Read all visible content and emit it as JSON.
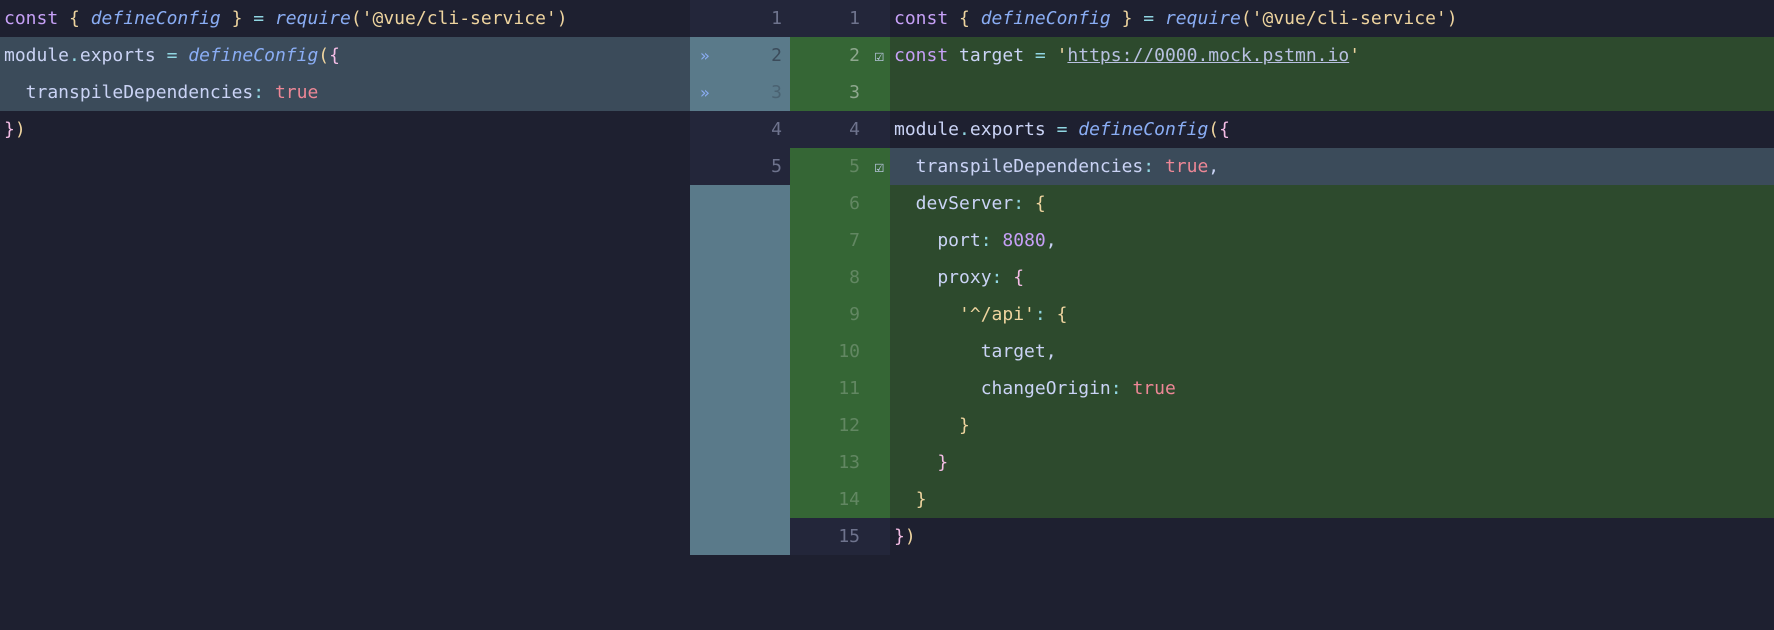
{
  "left": {
    "lines": [
      {
        "n": 1,
        "bg": "default",
        "tokens": [
          {
            "t": "const ",
            "c": "kw"
          },
          {
            "t": "{ ",
            "c": "paren-yellow"
          },
          {
            "t": "defineConfig",
            "c": "fn"
          },
          {
            "t": " }",
            "c": "paren-yellow"
          },
          {
            "t": " = ",
            "c": "op"
          },
          {
            "t": "require",
            "c": "fn"
          },
          {
            "t": "(",
            "c": "paren-yellow"
          },
          {
            "t": "'@vue/cli-service'",
            "c": "str"
          },
          {
            "t": ")",
            "c": "paren-yellow"
          }
        ]
      },
      {
        "n": 2,
        "bg": "modified-left",
        "tokens": [
          {
            "t": "module",
            "c": "default"
          },
          {
            "t": ".",
            "c": "op"
          },
          {
            "t": "exports",
            "c": "default"
          },
          {
            "t": " = ",
            "c": "op"
          },
          {
            "t": "defineConfig",
            "c": "fn"
          },
          {
            "t": "(",
            "c": "paren-yellow"
          },
          {
            "t": "{",
            "c": "paren-pink"
          }
        ]
      },
      {
        "n": 3,
        "bg": "modified-left",
        "tokens": [
          {
            "t": "  transpileDependencies",
            "c": "default"
          },
          {
            "t": ": ",
            "c": "op"
          },
          {
            "t": "true",
            "c": "bool"
          }
        ]
      },
      {
        "n": 4,
        "bg": "default",
        "tokens": [
          {
            "t": "}",
            "c": "paren-pink"
          },
          {
            "t": ")",
            "c": "paren-yellow"
          }
        ]
      },
      {
        "n": 5,
        "bg": "default",
        "tokens": []
      }
    ]
  },
  "gutterLeft": [
    {
      "n": "1",
      "bg": "default"
    },
    {
      "n": "2",
      "bg": "modified",
      "icon": "expand"
    },
    {
      "n": "3",
      "bg": "modified",
      "icon": "expand",
      "dim": true
    },
    {
      "n": "4",
      "bg": "default"
    },
    {
      "n": "5",
      "bg": "default"
    }
  ],
  "gutterRight": [
    {
      "n": "1",
      "bg": "default"
    },
    {
      "n": "2",
      "bg": "added",
      "icon": "check"
    },
    {
      "n": "3",
      "bg": "added"
    },
    {
      "n": "4",
      "bg": "default"
    },
    {
      "n": "5",
      "bg": "added",
      "icon": "check",
      "dim": true
    },
    {
      "n": "6",
      "bg": "added",
      "dim": true
    },
    {
      "n": "7",
      "bg": "added",
      "dim": true
    },
    {
      "n": "8",
      "bg": "added",
      "dim": true
    },
    {
      "n": "9",
      "bg": "added",
      "dim": true
    },
    {
      "n": "10",
      "bg": "added",
      "dim": true
    },
    {
      "n": "11",
      "bg": "added",
      "dim": true
    },
    {
      "n": "12",
      "bg": "added",
      "dim": true
    },
    {
      "n": "13",
      "bg": "added",
      "dim": true
    },
    {
      "n": "14",
      "bg": "added",
      "dim": true
    },
    {
      "n": "15",
      "bg": "default"
    }
  ],
  "right": {
    "lines": [
      {
        "n": 1,
        "bg": "default",
        "tokens": [
          {
            "t": "const ",
            "c": "kw"
          },
          {
            "t": "{ ",
            "c": "paren-yellow"
          },
          {
            "t": "defineConfig",
            "c": "fn"
          },
          {
            "t": " }",
            "c": "paren-yellow"
          },
          {
            "t": " = ",
            "c": "op"
          },
          {
            "t": "require",
            "c": "fn"
          },
          {
            "t": "(",
            "c": "paren-yellow"
          },
          {
            "t": "'@vue/cli-service'",
            "c": "str"
          },
          {
            "t": ")",
            "c": "paren-yellow"
          }
        ]
      },
      {
        "n": 2,
        "bg": "added",
        "tokens": [
          {
            "t": "const ",
            "c": "kw"
          },
          {
            "t": "target",
            "c": "default"
          },
          {
            "t": " = ",
            "c": "op"
          },
          {
            "t": "'",
            "c": "str"
          },
          {
            "t": "https://0000.mock.pstmn.io",
            "c": "url"
          },
          {
            "t": "'",
            "c": "str"
          }
        ]
      },
      {
        "n": 3,
        "bg": "added",
        "tokens": []
      },
      {
        "n": 4,
        "bg": "default",
        "tokens": [
          {
            "t": "module",
            "c": "default"
          },
          {
            "t": ".",
            "c": "op"
          },
          {
            "t": "exports",
            "c": "default"
          },
          {
            "t": " = ",
            "c": "op"
          },
          {
            "t": "defineConfig",
            "c": "fn"
          },
          {
            "t": "(",
            "c": "paren-yellow"
          },
          {
            "t": "{",
            "c": "paren-pink"
          }
        ]
      },
      {
        "n": 5,
        "bg": "line-highlight",
        "tokens": [
          {
            "t": "  transpileDependencies",
            "c": "default"
          },
          {
            "t": ": ",
            "c": "op"
          },
          {
            "t": "true",
            "c": "bool"
          },
          {
            "t": ",",
            "c": "default"
          }
        ]
      },
      {
        "n": 6,
        "bg": "added",
        "tokens": [
          {
            "t": "  devServer",
            "c": "default"
          },
          {
            "t": ": ",
            "c": "op"
          },
          {
            "t": "{",
            "c": "paren-yellow"
          }
        ]
      },
      {
        "n": 7,
        "bg": "added",
        "tokens": [
          {
            "t": "    port",
            "c": "default"
          },
          {
            "t": ": ",
            "c": "op"
          },
          {
            "t": "8080",
            "c": "num"
          },
          {
            "t": ",",
            "c": "default"
          }
        ]
      },
      {
        "n": 8,
        "bg": "added",
        "tokens": [
          {
            "t": "    proxy",
            "c": "default"
          },
          {
            "t": ": ",
            "c": "op"
          },
          {
            "t": "{",
            "c": "paren-pink"
          }
        ]
      },
      {
        "n": 9,
        "bg": "added",
        "tokens": [
          {
            "t": "      '^/api'",
            "c": "str"
          },
          {
            "t": ": ",
            "c": "op"
          },
          {
            "t": "{",
            "c": "paren-yellow"
          }
        ]
      },
      {
        "n": 10,
        "bg": "added",
        "tokens": [
          {
            "t": "        target",
            "c": "default"
          },
          {
            "t": ",",
            "c": "default"
          }
        ]
      },
      {
        "n": 11,
        "bg": "added",
        "tokens": [
          {
            "t": "        changeOrigin",
            "c": "default"
          },
          {
            "t": ": ",
            "c": "op"
          },
          {
            "t": "true",
            "c": "bool"
          }
        ]
      },
      {
        "n": 12,
        "bg": "added",
        "tokens": [
          {
            "t": "      ",
            "c": "default"
          },
          {
            "t": "}",
            "c": "paren-yellow"
          }
        ]
      },
      {
        "n": 13,
        "bg": "added",
        "tokens": [
          {
            "t": "    ",
            "c": "default"
          },
          {
            "t": "}",
            "c": "paren-pink"
          }
        ]
      },
      {
        "n": 14,
        "bg": "added",
        "tokens": [
          {
            "t": "  ",
            "c": "default"
          },
          {
            "t": "}",
            "c": "paren-yellow"
          }
        ]
      },
      {
        "n": 15,
        "bg": "default",
        "tokens": [
          {
            "t": "}",
            "c": "paren-pink"
          },
          {
            "t": ")",
            "c": "paren-yellow"
          }
        ]
      }
    ]
  },
  "icons": {
    "expand": "»",
    "check": "☑"
  }
}
